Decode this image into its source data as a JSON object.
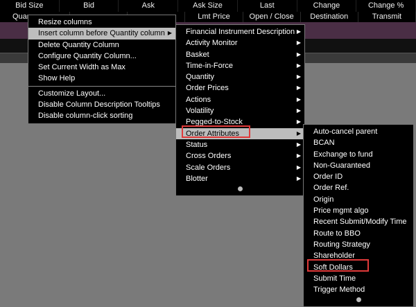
{
  "header_row": [
    "Bid Size",
    "Bid",
    "Ask",
    "Ask Size",
    "Last",
    "Change",
    "Change %"
  ],
  "subheader_row": [
    "Quan",
    "",
    "",
    "Lmt Price",
    "Open / Close",
    "Destination",
    "Transmit"
  ],
  "context_menu": {
    "items": [
      "Resize columns",
      "Insert column before Quantity column",
      "Delete Quantity Column",
      "Configure Quantity Column...",
      "Set Current Width as Max",
      "Show Help",
      "Customize Layout...",
      "Disable Column Description Tooltips",
      "Disable column-click sorting"
    ],
    "selected": "Insert column before Quantity column"
  },
  "category_menu": {
    "items": [
      "Financial Instrument Description",
      "Activity Monitor",
      "Basket",
      "Time-in-Force",
      "Quantity",
      "Order Prices",
      "Actions",
      "Volatility",
      "Pegged-to-Stock",
      "Order Attributes",
      "Status",
      "Cross Orders",
      "Scale Orders",
      "Blotter"
    ],
    "selected": "Order Attributes"
  },
  "attributes_menu": {
    "items": [
      "Auto-cancel parent",
      "BCAN",
      "Exchange to fund",
      "Non-Guaranteed",
      "Order ID",
      "Order Ref.",
      "Origin",
      "Price mgmt algo",
      "Recent Submit/Modify Time",
      "Route to BBO",
      "Routing Strategy",
      "Shareholder",
      "Soft Dollars",
      "Submit Time",
      "Trigger Method"
    ],
    "highlighted": "Soft Dollars"
  },
  "colors": {
    "highlight_box": "#e03a3a",
    "selected_bg": "#bdbdbd",
    "menu_bg": "#000000"
  }
}
